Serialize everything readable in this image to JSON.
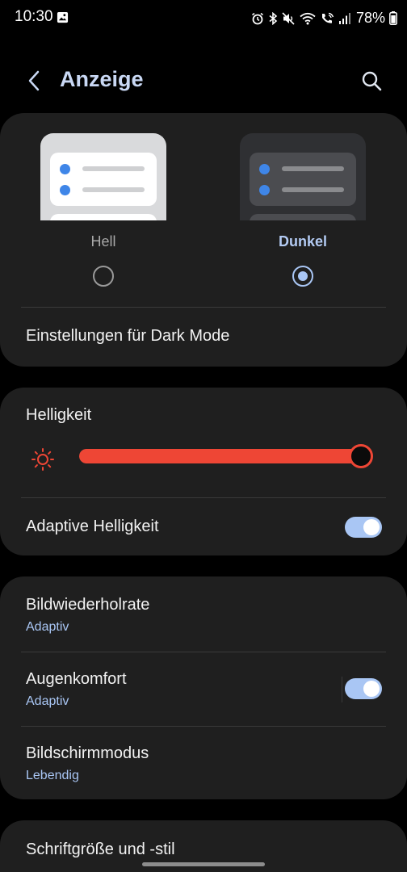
{
  "status_bar": {
    "time": "10:30",
    "battery_pct": "78%",
    "icons": [
      "gallery-icon",
      "alarm-icon",
      "bluetooth-icon",
      "mute-icon",
      "wifi-icon",
      "wifi-call-icon",
      "signal-icon",
      "battery-icon"
    ]
  },
  "header": {
    "title": "Anzeige",
    "back_icon": "chevron-left-icon",
    "search_icon": "search-icon"
  },
  "theme": {
    "options": [
      {
        "label": "Hell",
        "selected": false
      },
      {
        "label": "Dunkel",
        "selected": true
      }
    ],
    "dark_mode_settings": "Einstellungen für Dark Mode"
  },
  "brightness": {
    "title": "Helligkeit",
    "level": 1.0,
    "adaptive_label": "Adaptive Helligkeit",
    "adaptive_on": true
  },
  "display": {
    "items": [
      {
        "title": "Bildwiederholrate",
        "subtitle": "Adaptiv"
      },
      {
        "title": "Augenkomfort",
        "subtitle": "Adaptiv",
        "toggle_on": true
      },
      {
        "title": "Bildschirmmodus",
        "subtitle": "Lebendig"
      }
    ]
  },
  "font": {
    "title": "Schriftgröße und -stil"
  },
  "colors": {
    "accent": "#a9c6f4",
    "slider": "#ee4635",
    "card": "#1f1f1f",
    "background": "#000000"
  }
}
